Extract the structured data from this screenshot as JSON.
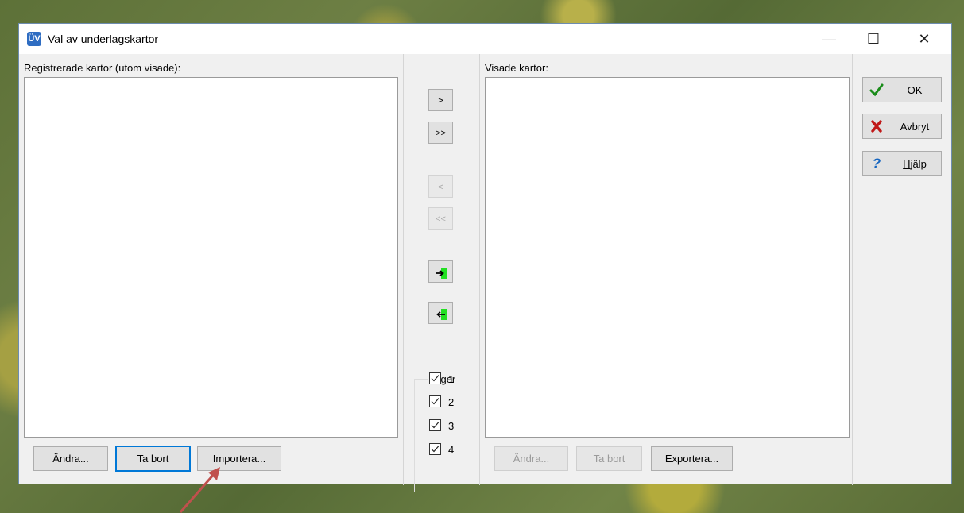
{
  "window": {
    "title": "Val av underlagskartor",
    "app_icon_text": "ÜV",
    "controls": {
      "minimize": "—",
      "maximize": "☐",
      "close": "✕"
    }
  },
  "left_panel": {
    "label": "Registrerade kartor (utom visade):",
    "buttons": {
      "edit": "Ändra...",
      "remove": "Ta bort",
      "import": "Importera..."
    }
  },
  "transfer": {
    "move_one_right": ">",
    "move_all_right": ">>",
    "move_one_left": "<",
    "move_all_left": "<<",
    "icons": [
      "arrow-into-green-icon",
      "arrow-out-green-icon"
    ]
  },
  "layers": {
    "legend": "Lager",
    "items": [
      {
        "label": "1",
        "checked": true
      },
      {
        "label": "2",
        "checked": true
      },
      {
        "label": "3",
        "checked": true
      },
      {
        "label": "4",
        "checked": true
      }
    ]
  },
  "right_panel": {
    "label": "Visade kartor:",
    "buttons": {
      "edit": "Ändra...",
      "remove": "Ta bort",
      "export": "Exportera..."
    }
  },
  "actions": {
    "ok": "OK",
    "cancel": "Avbryt",
    "help_prefix": "H",
    "help_rest": "jälp",
    "colors": {
      "ok_check": "#1a8c1a",
      "cancel_x": "#c01818",
      "help_q": "#1565c0"
    }
  },
  "annotation": {
    "arrow_color": "#c0504d"
  }
}
